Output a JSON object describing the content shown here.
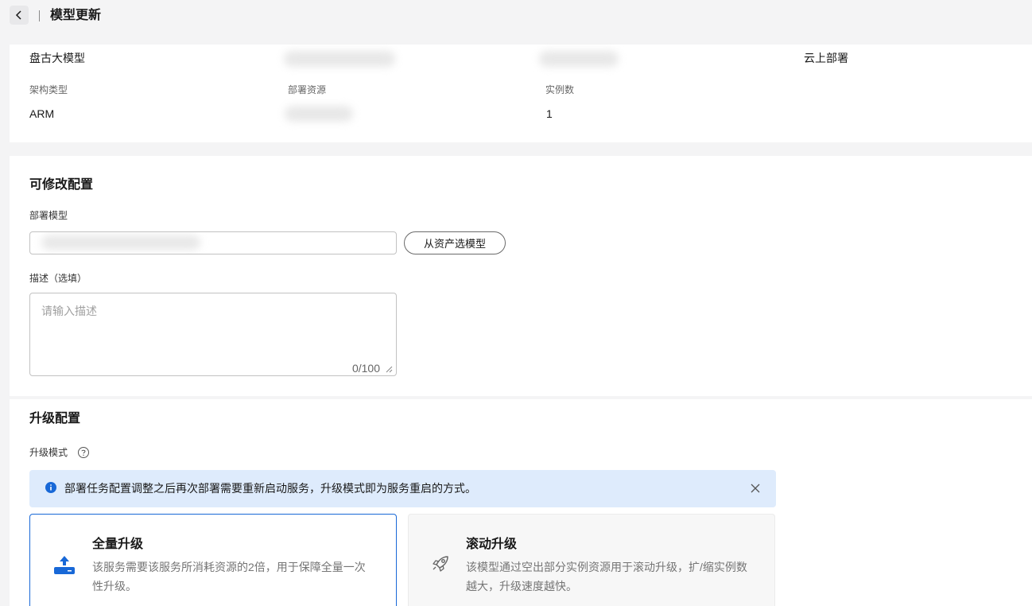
{
  "header": {
    "title": "模型更新"
  },
  "info": {
    "model_name": "盘古大模型",
    "deploy_location": "云上部署",
    "arch_label": "架构类型",
    "arch_value": "ARM",
    "resource_label": "部署资源",
    "instance_label": "实例数",
    "instance_value": "1"
  },
  "edit": {
    "section_title": "可修改配置",
    "model_label": "部署模型",
    "asset_button": "从资产选模型",
    "desc_label": "描述（选填）",
    "desc_placeholder": "请输入描述",
    "desc_count": "0/100"
  },
  "upgrade": {
    "section_title": "升级配置",
    "mode_label": "升级模式",
    "alert_text": "部署任务配置调整之后再次部署需要重新启动服务，升级模式即为服务重启的方式。",
    "modes": [
      {
        "title": "全量升级",
        "desc": "该服务需要该服务所消耗资源的2倍，用于保障全量一次性升级。",
        "selected": true,
        "icon": "upload-icon"
      },
      {
        "title": "滚动升级",
        "desc": "该模型通过空出部分实例资源用于滚动升级，扩/缩实例数越大，升级速度越快。",
        "selected": false,
        "icon": "rocket-icon"
      }
    ]
  },
  "colors": {
    "accent": "#1868d7",
    "alert_bg": "#deebfc",
    "page_bg": "#f4f4f5"
  }
}
